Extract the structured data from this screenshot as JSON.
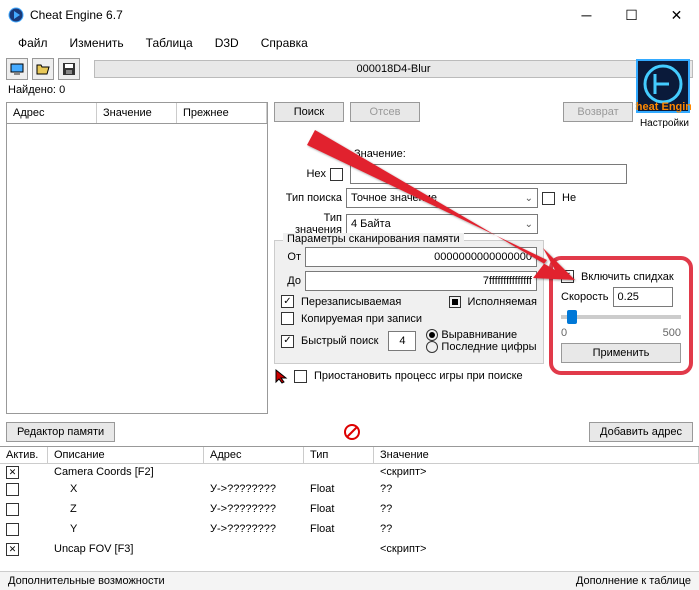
{
  "window": {
    "title": "Cheat Engine 6.7"
  },
  "menu": {
    "file": "Файл",
    "edit": "Изменить",
    "table": "Таблица",
    "d3d": "D3D",
    "help": "Справка"
  },
  "progress_label": "000018D4-Blur",
  "found": {
    "label": "Найдено:",
    "count": "0"
  },
  "list_header": {
    "address": "Адрес",
    "value": "Значение",
    "previous": "Прежнее"
  },
  "buttons": {
    "search": "Поиск",
    "filter": "Отсев",
    "undo": "Возврат",
    "memory_editor": "Редактор памяти",
    "add_address": "Добавить адрес",
    "apply": "Применить"
  },
  "labels": {
    "value": "Значение:",
    "hex": "Hex",
    "search_type": "Тип поиска",
    "value_type": "Тип значения",
    "not": "Не",
    "scan_params": "Параметры сканирования памяти",
    "from": "От",
    "to": "До",
    "writable": "Перезаписываемая",
    "executable": "Исполняемая",
    "cow": "Копируемая при записи",
    "fast_scan": "Быстрый поиск",
    "alignment": "Выравнивание",
    "last_digits": "Последние цифры",
    "pause_game": "Приостановить процесс игры при поиске",
    "enable_speedhack": "Включить спидхак",
    "speed": "Скорость",
    "settings": "Настройки"
  },
  "values": {
    "search_type": "Точное значение",
    "value_type": "4 Байта",
    "from": "0000000000000000",
    "to": "7fffffffffffffff",
    "fast_scan_val": "4",
    "speed": "0.25",
    "slider_min": "0",
    "slider_max": "500"
  },
  "table_header": {
    "active": "Актив.",
    "description": "Описание",
    "address": "Адрес",
    "type": "Тип",
    "value": "Значение"
  },
  "table_rows": [
    {
      "active": "x",
      "desc": "Camera Coords [F2]",
      "addr": "",
      "type": "",
      "val": "<скрипт>"
    },
    {
      "active": "",
      "desc": "X",
      "addr": "У->????????",
      "type": "Float",
      "val": "??"
    },
    {
      "active": "",
      "desc": "Z",
      "addr": "У->????????",
      "type": "Float",
      "val": "??"
    },
    {
      "active": "",
      "desc": "Y",
      "addr": "У->????????",
      "type": "Float",
      "val": "??"
    },
    {
      "active": "x",
      "desc": "Uncap FOV [F3]",
      "addr": "",
      "type": "",
      "val": "<скрипт>"
    }
  ],
  "status": {
    "left": "Дополнительные возможности",
    "right": "Дополнение к таблице"
  }
}
